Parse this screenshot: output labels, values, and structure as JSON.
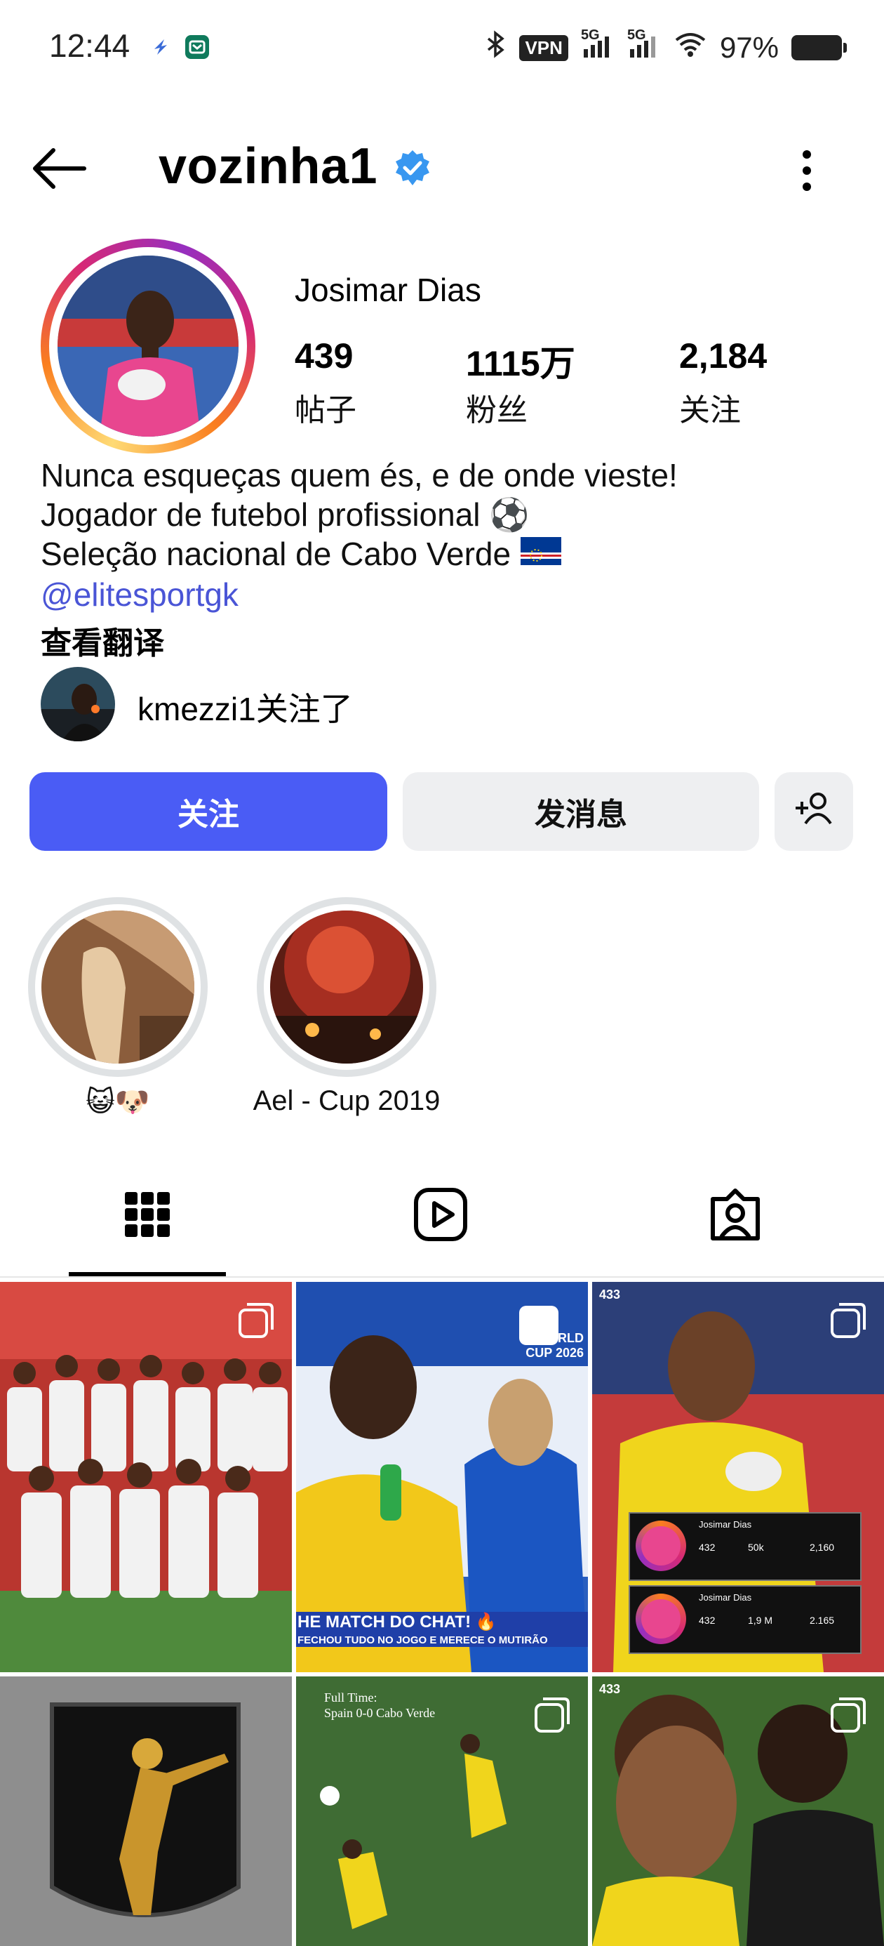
{
  "status_bar": {
    "time": "12:44",
    "vpn": "VPN",
    "network_1": "5G",
    "network_2": "5G",
    "battery": "97%"
  },
  "header": {
    "username": "vozinha1",
    "verified": true
  },
  "profile": {
    "display_name": "Josimar Dias",
    "stats": [
      {
        "value": "439",
        "label": "帖子"
      },
      {
        "value": "1115万",
        "label": "粉丝"
      },
      {
        "value": "2,184",
        "label": "关注"
      }
    ],
    "bio": [
      "Nunca esqueças quem és, e de onde vieste!",
      "Jogador de futebol profissional ⚽",
      "Seleção nacional de Cabo Verde"
    ],
    "link": "@elitesportgk",
    "translate": "查看翻译",
    "followed_by": "kmezzi1关注了"
  },
  "buttons": {
    "follow": "关注",
    "message": "发消息"
  },
  "highlights": [
    {
      "label": "😺🐶"
    },
    {
      "label": "Ael - Cup 2019"
    }
  ],
  "tabs": [
    "grid-icon",
    "reels-icon",
    "tagged-icon"
  ],
  "posts": {
    "post_2_caption": "HE MATCH DO CHAT! 🔥",
    "post_2_subcaption": "FECHOU TUDO NO JOGO E MERECE O MUTIRÃO",
    "post_2_badge": "WORLD CUP 2026",
    "post_3_card_1": {
      "name": "Josimar Dias",
      "posts": "432",
      "followers": "50k",
      "following": "2,160"
    },
    "post_3_card_2": {
      "name": "Josimar Dias",
      "posts": "432",
      "followers": "1,9 M",
      "following": "2.165"
    },
    "post_5_caption_line1": "Full Time:",
    "post_5_caption_line2": "Spain 0-0 Cabo Verde",
    "watermark": "433"
  },
  "colors": {
    "accent": "#4a5cf5",
    "link": "#4a55d6",
    "verified": "#3897f0"
  }
}
